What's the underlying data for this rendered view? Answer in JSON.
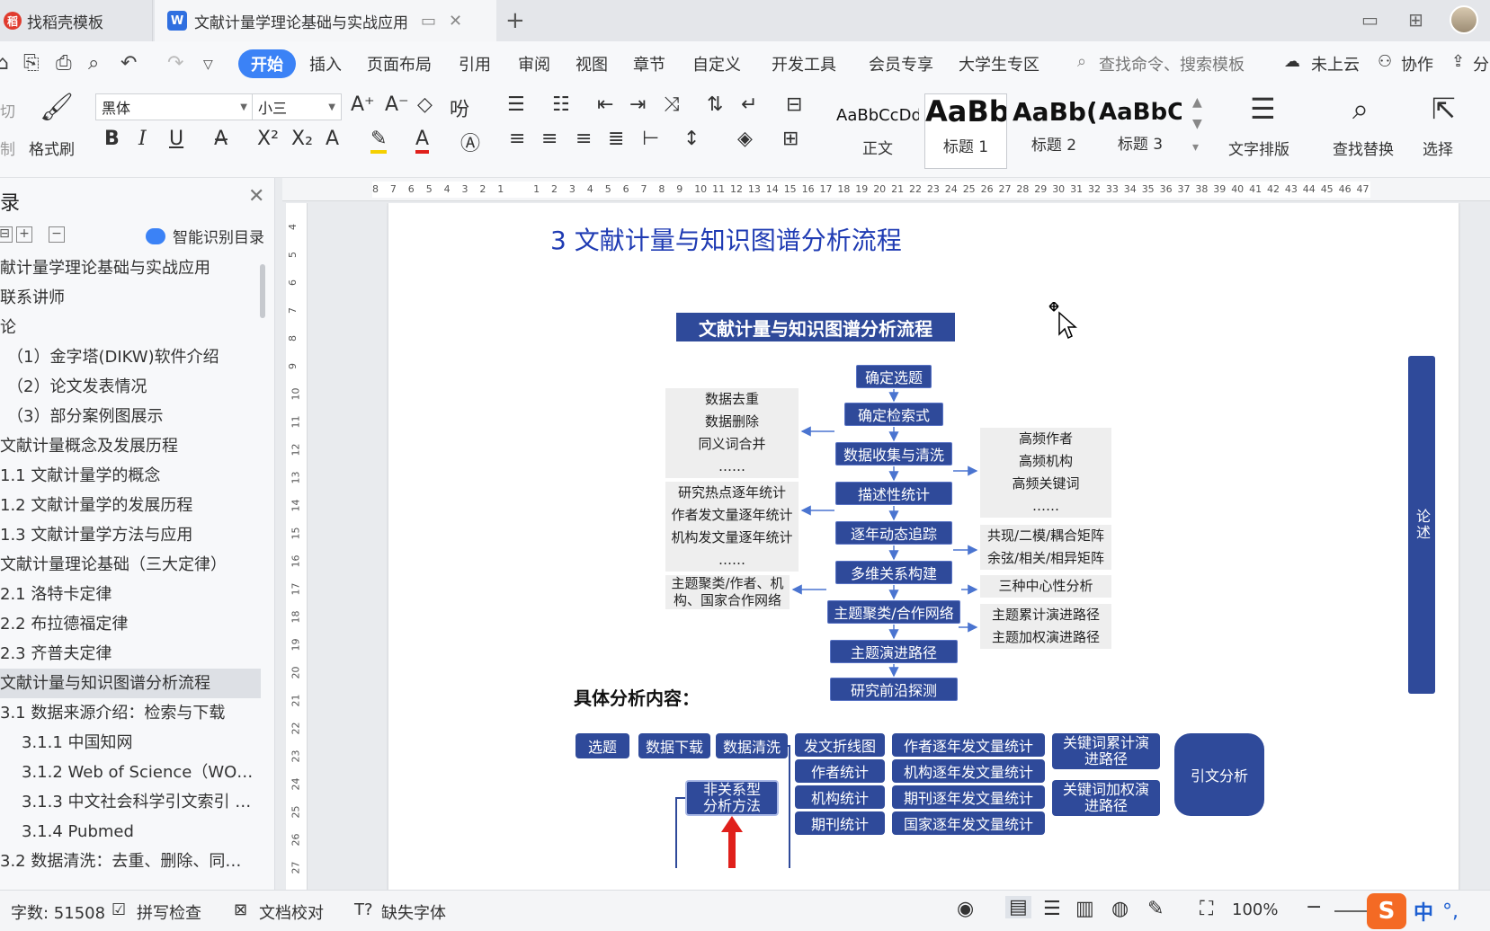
{
  "tabs": [
    {
      "label": "找稻壳模板"
    },
    {
      "label": "文献计量学理论基础与实战应用"
    }
  ],
  "menu": {
    "active": "开始",
    "items": [
      "插入",
      "页面布局",
      "引用",
      "审阅",
      "视图",
      "章节",
      "自定义",
      "开发工具",
      "会员专享",
      "大学生专区"
    ],
    "search_placeholder": "查找命令、搜索模板",
    "cloud": "未上云",
    "collab": "协作",
    "share": "分"
  },
  "ribbon": {
    "cut": "切",
    "copy": "制",
    "format_painter": "格式刷",
    "font_name": "黑体",
    "font_size": "小三",
    "styles": [
      {
        "sample": "AaBbCcDd",
        "name": "正文"
      },
      {
        "sample": "AaBb",
        "name": "标题 1"
      },
      {
        "sample": "AaBb(",
        "name": "标题 2"
      },
      {
        "sample": "AaBbC",
        "name": "标题 3"
      }
    ],
    "text_layout": "文字排版",
    "find_replace": "查找替换",
    "select": "选择"
  },
  "nav": {
    "title": "录",
    "smart": "智能识别目录",
    "items": [
      {
        "label": "献计量学理论基础与实战应用",
        "indent": 0,
        "active": false
      },
      {
        "label": "联系讲师",
        "indent": 0,
        "active": false
      },
      {
        "label": "论",
        "indent": 0,
        "active": false
      },
      {
        "label": "（1）金字塔(DIKW)软件介绍",
        "indent": 1,
        "active": false
      },
      {
        "label": "（2）论文发表情况",
        "indent": 1,
        "active": false
      },
      {
        "label": "（3）部分案例图展示",
        "indent": 1,
        "active": false
      },
      {
        "label": "文献计量概念及发展历程",
        "indent": 0,
        "active": false
      },
      {
        "label": "1.1 文献计量学的概念",
        "indent": 0,
        "active": false
      },
      {
        "label": "1.2 文献计量学的发展历程",
        "indent": 0,
        "active": false
      },
      {
        "label": "1.3 文献计量学方法与应用",
        "indent": 0,
        "active": false
      },
      {
        "label": "文献计量理论基础（三大定律）",
        "indent": 0,
        "active": false
      },
      {
        "label": "2.1 洛特卡定律",
        "indent": 0,
        "active": false
      },
      {
        "label": "2.2 布拉德福定律",
        "indent": 0,
        "active": false
      },
      {
        "label": "2.3 齐普夫定律",
        "indent": 0,
        "active": false
      },
      {
        "label": "文献计量与知识图谱分析流程",
        "indent": 0,
        "active": true
      },
      {
        "label": "3.1 数据来源介绍：检索与下载",
        "indent": 0,
        "active": false
      },
      {
        "label": "3.1.1  中国知网",
        "indent": 2,
        "active": false
      },
      {
        "label": "3.1.2 Web of Science（WO…",
        "indent": 2,
        "active": false
      },
      {
        "label": "3.1.3  中文社会科学引文索引 …",
        "indent": 2,
        "active": false
      },
      {
        "label": "3.1.4 Pubmed",
        "indent": 2,
        "active": false
      },
      {
        "label": "3.2 数据清洗：去重、删除、同…",
        "indent": 0,
        "active": false
      }
    ]
  },
  "ruler": {
    "h": [
      "8",
      "7",
      "6",
      "5",
      "4",
      "3",
      "2",
      "1",
      "",
      "1",
      "2",
      "3",
      "4",
      "5",
      "6",
      "7",
      "8",
      "9",
      "10",
      "11",
      "12",
      "13",
      "14",
      "15",
      "16",
      "17",
      "18",
      "19",
      "20",
      "21",
      "22",
      "23",
      "24",
      "25",
      "26",
      "27",
      "28",
      "29",
      "30",
      "31",
      "32",
      "33",
      "34",
      "35",
      "36",
      "37",
      "38",
      "39",
      "40",
      "41",
      "42",
      "43",
      "44",
      "45",
      "46",
      "47"
    ],
    "v": [
      "4",
      "5",
      "6",
      "7",
      "8",
      "9",
      "10",
      "11",
      "12",
      "13",
      "14",
      "15",
      "16",
      "17",
      "18",
      "19",
      "20",
      "21",
      "22",
      "23",
      "24",
      "25",
      "26",
      "27"
    ]
  },
  "doc": {
    "heading": "3  文献计量与知识图谱分析流程",
    "flow": {
      "title": "文献计量与知识图谱分析流程",
      "steps": [
        "确定选题",
        "确定检索式",
        "数据收集与清洗",
        "描述性统计",
        "逐年动态追踪",
        "多维关系构建",
        "主题聚类/合作网络",
        "主题演进路径",
        "研究前沿探测"
      ],
      "left_cleaning": [
        "数据去重",
        "数据删除",
        "同义词合并",
        "……"
      ],
      "left_tracking": [
        "研究热点逐年统计",
        "作者发文量逐年统计",
        "机构发文量逐年统计",
        "……"
      ],
      "left_cluster": [
        "主题聚类/作者、机",
        "构、国家合作网络"
      ],
      "right_desc": [
        "高频作者",
        "高频机构",
        "高频关键词",
        "……"
      ],
      "right_matrix": [
        "共现/二模/耦合矩阵",
        "余弦/相关/相异矩阵"
      ],
      "right_centrality": [
        "三种中心性分析"
      ],
      "right_evolution": [
        "主题累计演进路径",
        "主题加权演进路径"
      ],
      "side": "论述"
    },
    "subhead": "具体分析内容：",
    "pills": {
      "row1": [
        "选题",
        "数据下载",
        "数据清洗"
      ],
      "stats": [
        "发文折线图",
        "作者统计",
        "机构统计",
        "期刊统计"
      ],
      "yearly": [
        "作者逐年发文量统计",
        "机构逐年发文量统计",
        "期刊逐年发文量统计",
        "国家逐年发文量统计"
      ],
      "keyword_cum": "关键词累计演进路径",
      "keyword_w": "关键词加权演进路径",
      "citation": "引文分析",
      "nonrel": "非关系型分析方法"
    }
  },
  "status": {
    "words": "字数: 51508",
    "spell": "拼写检查",
    "proof": "文档校对",
    "missing_font": "缺失字体",
    "zoom": "100%",
    "ime": "中"
  },
  "colors": {
    "accent": "#3b82f6",
    "navy": "#2f4a9a",
    "heading": "#1f3bb3",
    "arrow": "#4a74d0",
    "red": "#e0201b"
  }
}
